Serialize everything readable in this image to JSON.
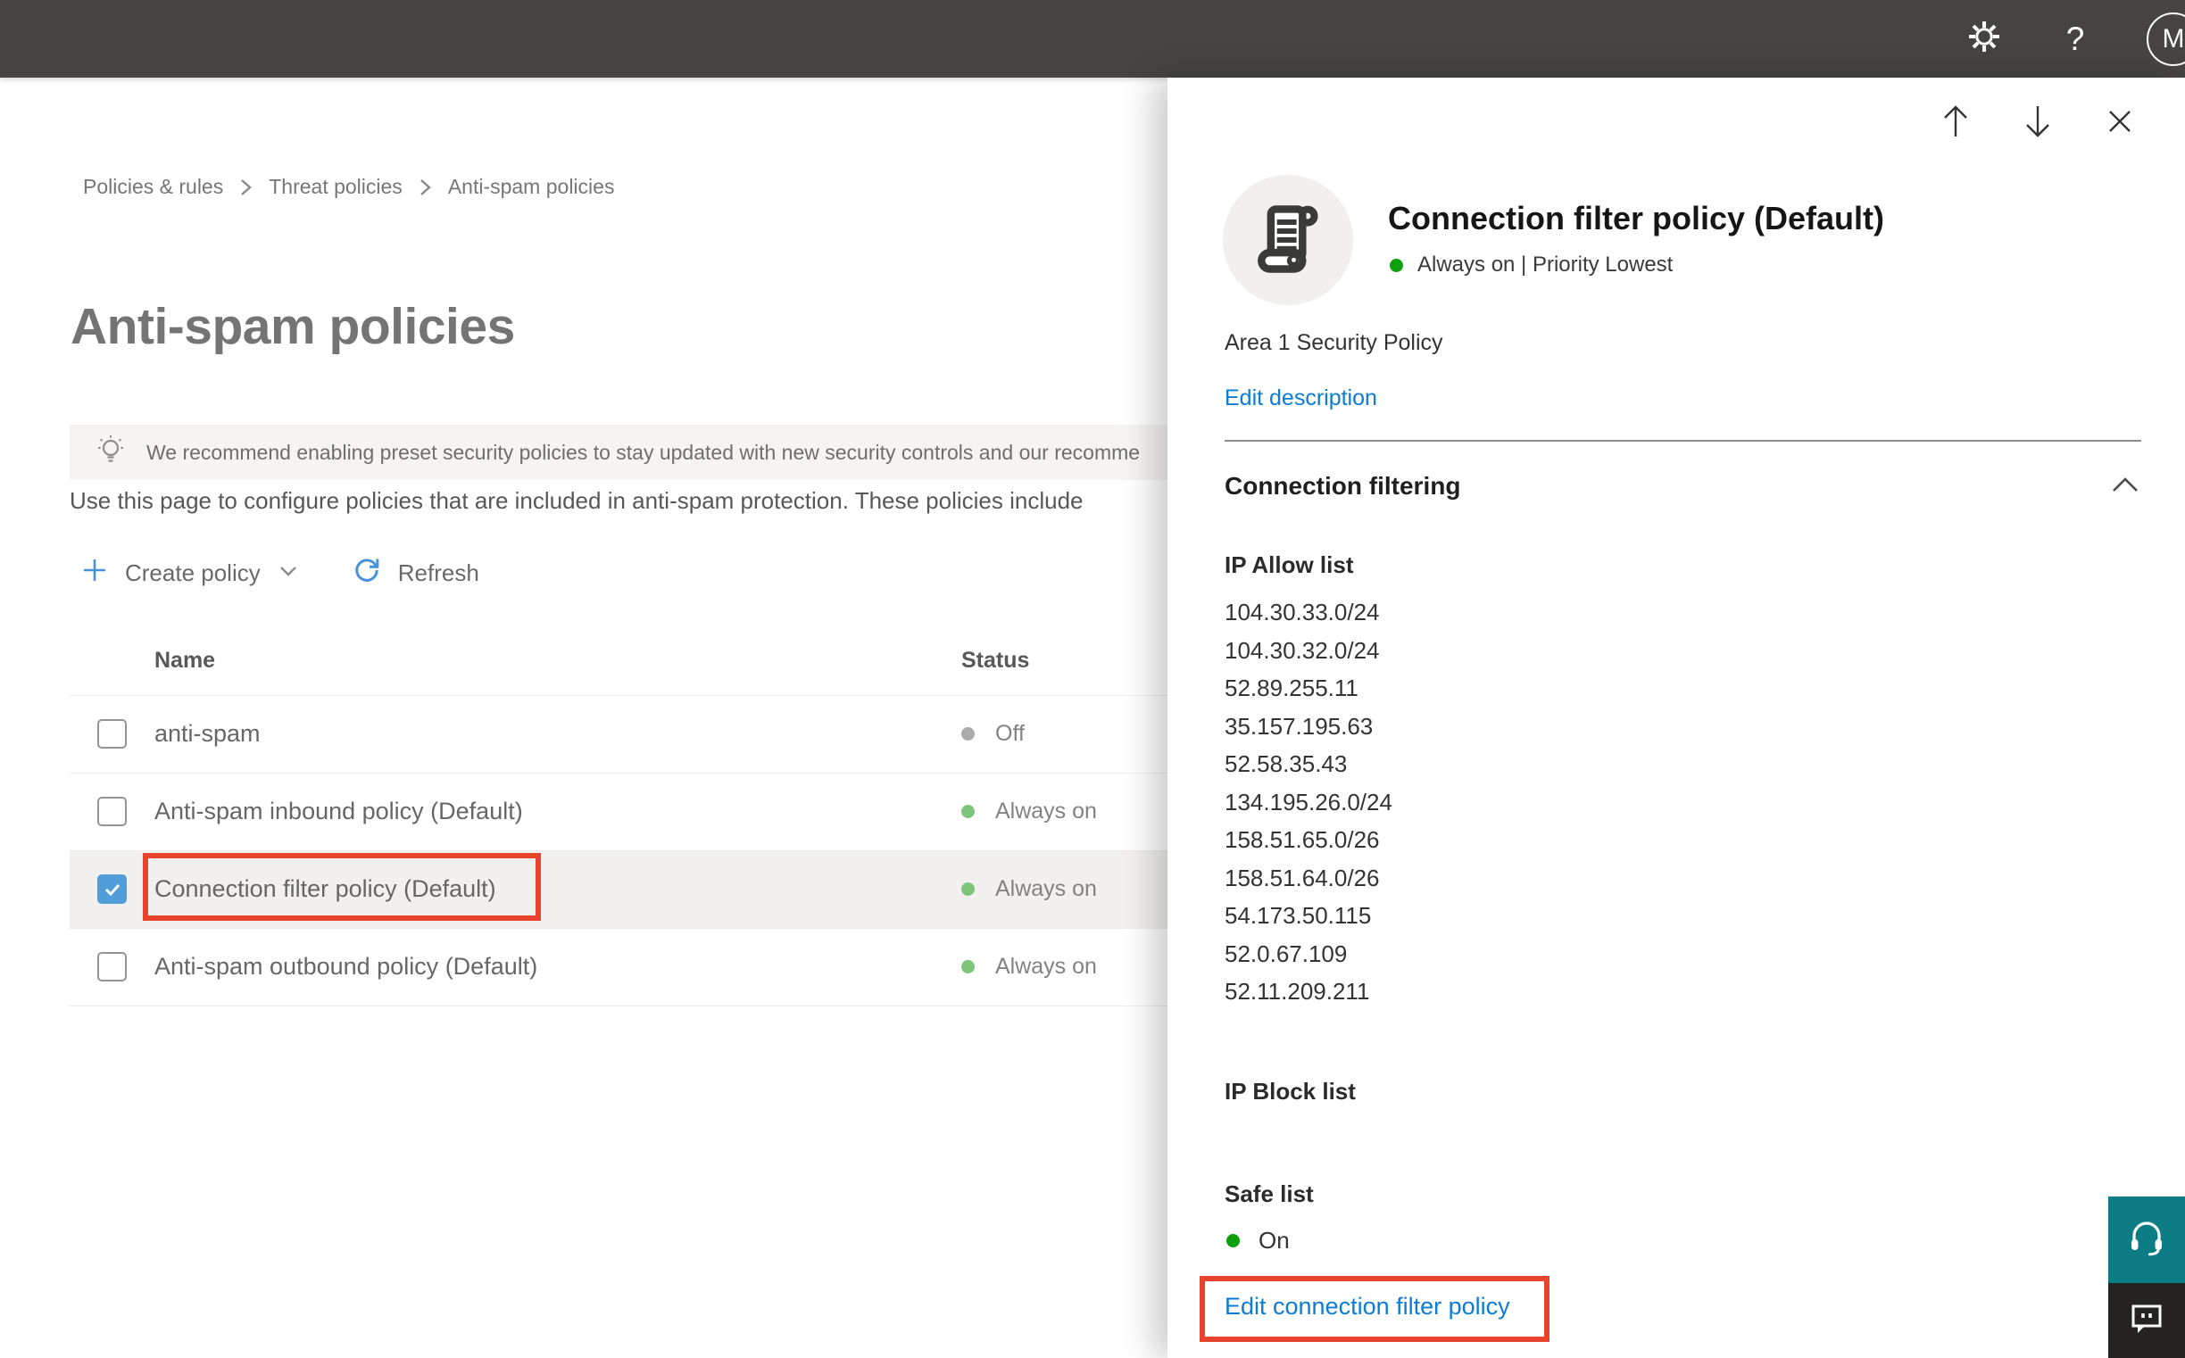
{
  "topbar": {
    "avatar_initial": "M"
  },
  "breadcrumb": {
    "items": [
      "Policies & rules",
      "Threat policies",
      "Anti-spam policies"
    ]
  },
  "page": {
    "title": "Anti-spam policies",
    "banner_text": "We recommend enabling preset security policies to stay updated with new security controls and our recomme",
    "description": "Use this page to configure policies that are included in anti-spam protection. These policies include"
  },
  "toolbar": {
    "create_policy_label": "Create policy",
    "refresh_label": "Refresh"
  },
  "table": {
    "columns": [
      "Name",
      "Status"
    ],
    "rows": [
      {
        "name": "anti-spam",
        "status": "Off",
        "status_color": "#ababab",
        "checked": false,
        "selected": false
      },
      {
        "name": "Anti-spam inbound policy (Default)",
        "status": "Always on",
        "status_color": "#7cc57b",
        "checked": false,
        "selected": false
      },
      {
        "name": "Connection filter policy (Default)",
        "status": "Always on",
        "status_color": "#7cc57b",
        "checked": true,
        "selected": true,
        "annotated": true
      },
      {
        "name": "Anti-spam outbound policy (Default)",
        "status": "Always on",
        "status_color": "#7cc57b",
        "checked": false,
        "selected": false
      }
    ]
  },
  "flyout": {
    "title": "Connection filter policy (Default)",
    "status_line": "Always on | Priority Lowest",
    "description": "Area 1 Security Policy",
    "edit_description_label": "Edit description",
    "section_title": "Connection filtering",
    "ip_allow": {
      "heading": "IP Allow list",
      "ips": [
        "104.30.33.0/24",
        "104.30.32.0/24",
        "52.89.255.11",
        "35.157.195.63",
        "52.58.35.43",
        "134.195.26.0/24",
        "158.51.65.0/26",
        "158.51.64.0/26",
        "54.173.50.115",
        "52.0.67.109",
        "52.11.209.211"
      ]
    },
    "ip_block": {
      "heading": "IP Block list"
    },
    "safe_list": {
      "heading": "Safe list",
      "value": "On"
    },
    "edit_link_label": "Edit connection filter policy"
  },
  "icons": {
    "gear-icon": "settings gear",
    "help-icon": "?",
    "lightbulb-icon": "recommendation bulb",
    "add-icon": "+",
    "refresh-icon": "circular arrow",
    "chevron-down-icon": "v",
    "chevron-up-icon": "^",
    "arrow-up-icon": "previous item",
    "arrow-down-icon": "next item",
    "close-icon": "x",
    "scroll-policy-icon": "policy scroll",
    "headset-icon": "support headset",
    "feedback-icon": "feedback bubble"
  },
  "colors": {
    "topbar_bg": "#454442",
    "annotation_red": "#e8432c",
    "link_blue": "#0c7cd5",
    "status_green_soft": "#7cc57b",
    "status_green_bright": "#0ca10c",
    "status_gray": "#ababab",
    "support_teal": "#0d7d85"
  }
}
